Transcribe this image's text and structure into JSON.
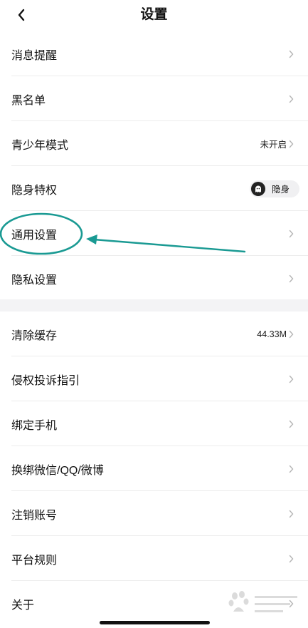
{
  "header": {
    "title": "设置",
    "back_icon": "chevron-left-icon"
  },
  "group1": [
    {
      "label": "消息提醒"
    },
    {
      "label": "黑名单"
    },
    {
      "label": "青少年模式",
      "value": "未开启"
    },
    {
      "label": "隐身特权",
      "toggle_label": "隐身"
    },
    {
      "label": "通用设置"
    },
    {
      "label": "隐私设置"
    }
  ],
  "group2": [
    {
      "label": "清除缓存",
      "value": "44.33M"
    },
    {
      "label": "侵权投诉指引"
    },
    {
      "label": "绑定手机"
    },
    {
      "label": "换绑微信/QQ/微博"
    },
    {
      "label": "注销账号"
    },
    {
      "label": "平台规则"
    },
    {
      "label": "关于"
    }
  ],
  "colors": {
    "annotation": "#1a9a93",
    "section_gap": "#f3f3f5",
    "chevron": "#b5b5b5"
  }
}
